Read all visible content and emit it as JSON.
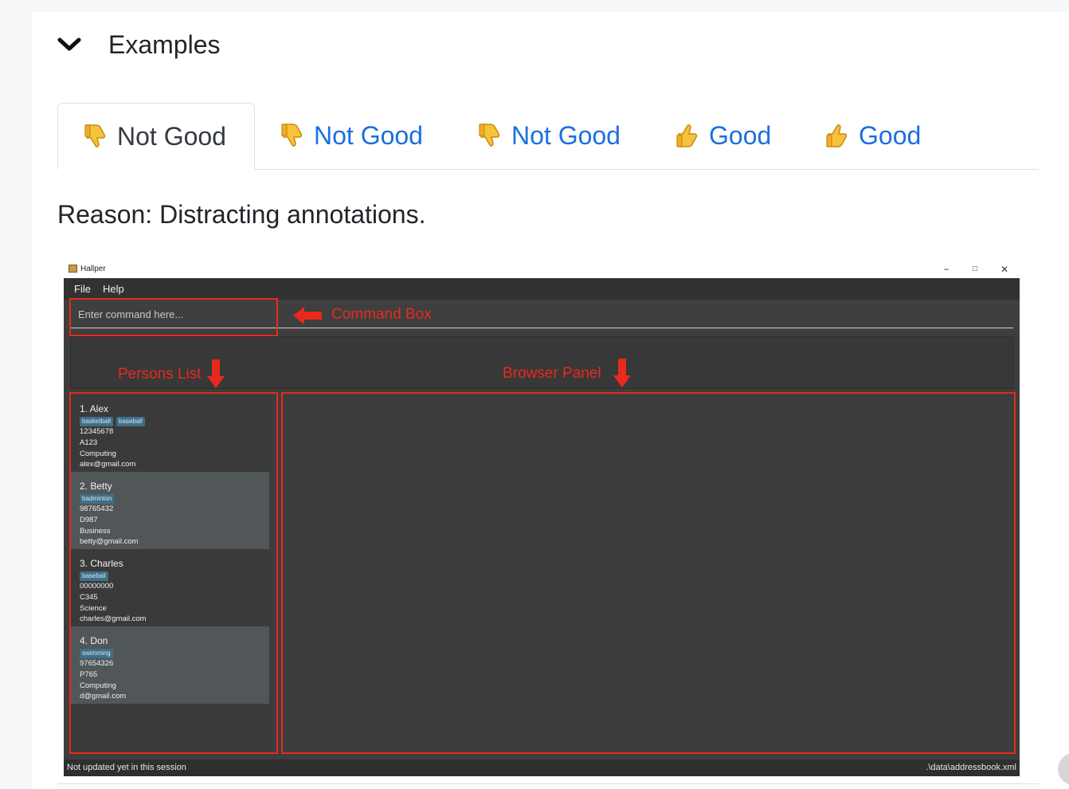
{
  "section": {
    "title": "Examples"
  },
  "tabs": [
    {
      "label": "Not Good",
      "kind": "thumbs-down",
      "active": true
    },
    {
      "label": "Not Good",
      "kind": "thumbs-down",
      "active": false
    },
    {
      "label": "Not Good",
      "kind": "thumbs-down",
      "active": false
    },
    {
      "label": "Good",
      "kind": "thumbs-up",
      "active": false
    },
    {
      "label": "Good",
      "kind": "thumbs-up",
      "active": false
    }
  ],
  "reason": "Reason: Distracting annotations.",
  "app": {
    "title": "Hallper",
    "menus": [
      "File",
      "Help"
    ],
    "command_placeholder": "Enter command here...",
    "persons": [
      {
        "name": "1.  Alex",
        "tags": [
          "basketball",
          "baseball"
        ],
        "phone": "12345678",
        "room": "A123",
        "faculty": "Computing",
        "email": "alex@gmail.com"
      },
      {
        "name": "2.  Betty",
        "tags": [
          "badminton"
        ],
        "phone": "98765432",
        "room": "D987",
        "faculty": "Business",
        "email": "betty@gmail.com"
      },
      {
        "name": "3.  Charles",
        "tags": [
          "baseball"
        ],
        "phone": "00000000",
        "room": "C345",
        "faculty": "Science",
        "email": "charles@gmail.com"
      },
      {
        "name": "4.  Don",
        "tags": [
          "swimming"
        ],
        "phone": "97654326",
        "room": "P765",
        "faculty": "Computing",
        "email": "d@gmail.com"
      }
    ],
    "status_left": "Not updated yet in this session",
    "status_right": ".\\data\\addressbook.xml"
  },
  "annotations": {
    "command_box": "Command Box",
    "persons_list": "Persons List",
    "browser_panel": "Browser Panel"
  },
  "colors": {
    "link_blue": "#1a6fe0",
    "annotation_red": "#e8291d",
    "app_bg": "#3d3d3d"
  }
}
